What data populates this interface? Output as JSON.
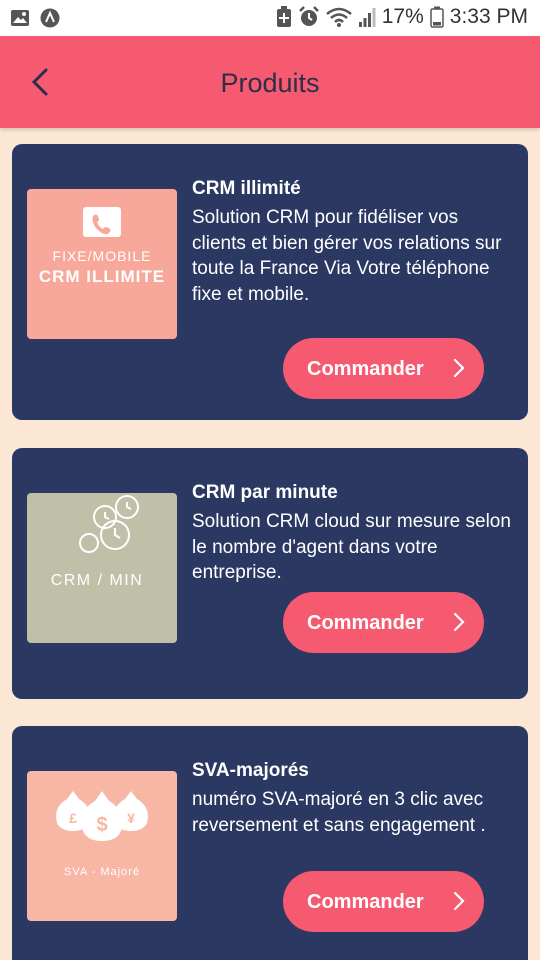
{
  "status_bar": {
    "battery_percent": "17%",
    "time": "3:33 PM",
    "icons": [
      "image-icon",
      "app-a-icon",
      "battery-saver-icon",
      "alarm-icon",
      "wifi-icon",
      "signal-icon",
      "battery-icon"
    ]
  },
  "header": {
    "title": "Produits",
    "back_icon": "chevron-left-icon",
    "background": "#f65a70"
  },
  "colors": {
    "page_background": "#fbe7d3",
    "card_background": "#2a3862",
    "button_background": "#f65a70"
  },
  "products": [
    {
      "title": "CRM illimité",
      "description": "Solution CRM pour fidéliser vos clients et bien gérer vos relations sur toute la France Via Votre téléphone fixe et mobile.",
      "image": {
        "line1": "FIXE/MOBILE",
        "line2": "CRM ILLIMITE",
        "icon": "phone-icon",
        "background": "#f8a89a"
      },
      "button_label": "Commander",
      "button_icon": "chevron-right-icon"
    },
    {
      "title": "CRM par minute",
      "description": "Solution CRM cloud sur mesure selon le nombre d'agent dans votre entreprise.",
      "image": {
        "line1": "CRM / MIN",
        "icon": "clocks-icon",
        "background": "#c0bfa8"
      },
      "button_label": "Commander",
      "button_icon": "chevron-right-icon"
    },
    {
      "title": "SVA-majorés",
      "description": "numéro SVA-majoré en 3 clic avec reversement et sans engagement .",
      "image": {
        "line1": "SVA - Majoré",
        "icon": "money-bags-icon",
        "background": "#f8b6a4"
      },
      "button_label": "Commander",
      "button_icon": "chevron-right-icon"
    }
  ]
}
